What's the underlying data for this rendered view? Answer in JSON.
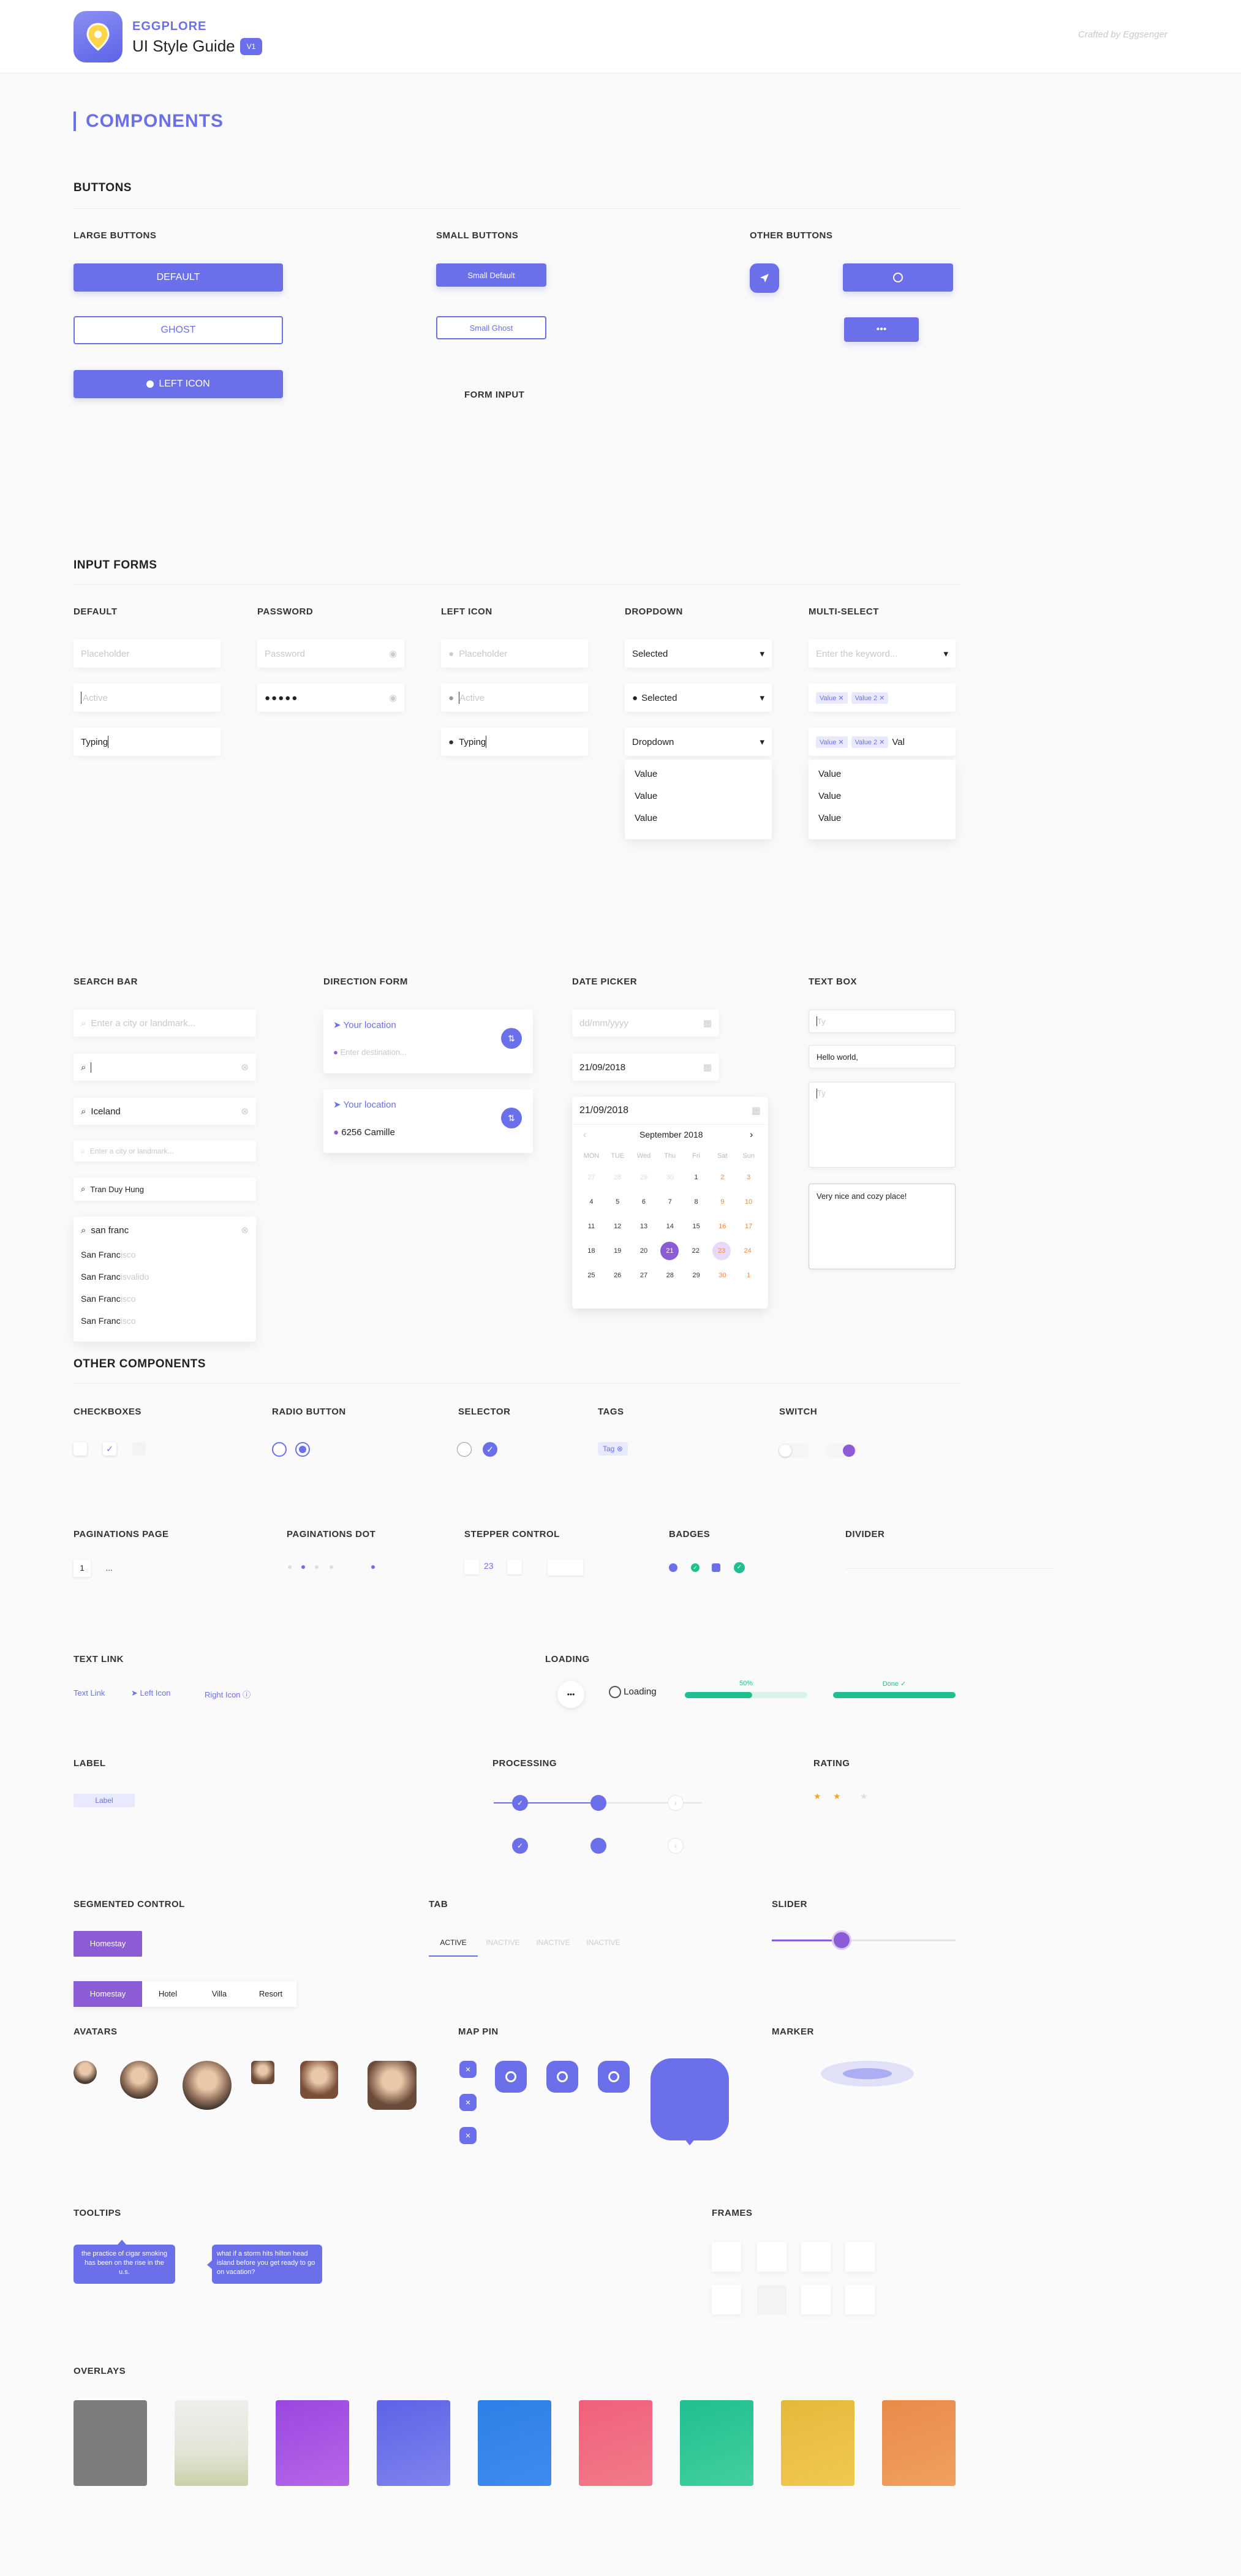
{
  "header": {
    "brand": "EGGPLORE",
    "title": "UI Style Guide",
    "version": "V1",
    "credit": "Crafted by Eggsenger"
  },
  "page_title": "COMPONENTS",
  "buttons": {
    "section": "BUTTONS",
    "large_title": "LARGE BUTTONS",
    "small_title": "SMALL BUTTONS",
    "other_title": "OTHER BUTTONS",
    "default": "DEFAULT",
    "ghost": "GHOST",
    "left_icon": "LEFT ICON",
    "small_default": "Small Default",
    "small_ghost": "Small Ghost",
    "ellipsis": "•••",
    "form_input": "FORM INPUT"
  },
  "inputs": {
    "section": "INPUT FORMS",
    "default_title": "DEFAULT",
    "password_title": "PASSWORD",
    "lefticon_title": "LEFT ICON",
    "dropdown_title": "DROPDOWN",
    "multi_title": "MULTI-SELECT",
    "placeholder": "Placeholder",
    "active": "Active",
    "typing": "Typing",
    "password_ph": "Password",
    "password_dots": "●●●●●",
    "selected": "Selected",
    "dropdown": "Dropdown",
    "value": "Value",
    "keyword_ph": "Enter the keyword...",
    "chip1": "Value",
    "chip2": "Value 2",
    "typed": "Val",
    "dropdown_opts": [
      "Value",
      "Value",
      "Value"
    ],
    "multi_opts": [
      "Value",
      "Value",
      "Value"
    ]
  },
  "search": {
    "title": "SEARCH BAR",
    "ph": "Enter a city or landmark...",
    "iceland": "Iceland",
    "small_ph": "Enter a city or landmark...",
    "tran": "Tran Duy Hung",
    "query": "san franc",
    "results": [
      {
        "match": "San Franc",
        "rest": "isco"
      },
      {
        "match": "San Franc",
        "rest": "isvalido"
      },
      {
        "match": "San Franc",
        "rest": "isco"
      },
      {
        "match": "San Franc",
        "rest": "isco"
      }
    ]
  },
  "direction": {
    "title": "DIRECTION FORM",
    "your_location": "Your location",
    "dest_ph": "Enter destination...",
    "dest": "6256 Camille"
  },
  "datepicker": {
    "title": "DATE PICKER",
    "ph": "dd/mm/yyyy",
    "date": "21/09/2018",
    "month": "September 2018",
    "weekdays": [
      "MON",
      "TUE",
      "Wed",
      "Thu",
      "Fri",
      "Sat",
      "Sun"
    ],
    "rows": [
      [
        "27",
        "28",
        "29",
        "30",
        "1",
        "2",
        "3"
      ],
      [
        "4",
        "5",
        "6",
        "7",
        "8",
        "9",
        "10"
      ],
      [
        "11",
        "12",
        "13",
        "14",
        "15",
        "16",
        "17"
      ],
      [
        "18",
        "19",
        "20",
        "21",
        "22",
        "23",
        "24"
      ],
      [
        "25",
        "26",
        "27",
        "28",
        "29",
        "30",
        "1"
      ]
    ]
  },
  "textbox": {
    "title": "TEXT BOX",
    "ph": "Ty",
    "hello": "Hello world,",
    "ty": "Ty",
    "nice": "Very nice and cozy place!"
  },
  "other": {
    "section": "OTHER COMPONENTS",
    "checkboxes": "CHECKBOXES",
    "radio": "RADIO BUTTON",
    "selector": "SELECTOR",
    "tags": "TAGS",
    "switch": "SWITCH",
    "tag": "Tag",
    "pag_page": "PAGINATIONS PAGE",
    "pag_page_num": "1",
    "pag_page_more": "...",
    "pag_dot": "PAGINATIONS DOT",
    "stepper": "STEPPER CONTROL",
    "stepper_val": "23",
    "badges": "BADGES",
    "divider": "DIVIDER",
    "textlink": "TEXT LINK",
    "link_text": "Text Link",
    "link_left": "Left Icon",
    "link_right": "Right Icon",
    "loading": "LOADING",
    "loading_text": "Loading",
    "progress_label": "50%",
    "progress": 0.55,
    "done_label": "Done ✓",
    "label": "LABEL",
    "label_text": "Label",
    "processing": "PROCESSING",
    "rating": "RATING",
    "segmented": "SEGMENTED CONTROL",
    "seg_single": "Homestay",
    "seg_items": [
      "Homestay",
      "Hotel",
      "Villa",
      "Resort"
    ],
    "tab": "TAB",
    "tabs": [
      "ACTIVE",
      "INACTIVE",
      "INACTIVE",
      "INACTIVE"
    ],
    "slider": "SLIDER",
    "slider_value": 0.38,
    "avatars": "AVATARS",
    "mappin": "MAP PIN",
    "marker": "MARKER",
    "tooltips": "TOOLTIPS",
    "tip1": "the practice of cigar smoking has been on the rise in the u.s.",
    "tip2": "what if a storm hits hilton head island before you get ready to go on vacation?",
    "frames": "FRAMES",
    "overlays": "OVERLAYS"
  },
  "colors": {
    "accent": "#6b70ea",
    "purple": "#8b5cd6",
    "green": "#1fbf8f",
    "orange": "#f5a623"
  }
}
